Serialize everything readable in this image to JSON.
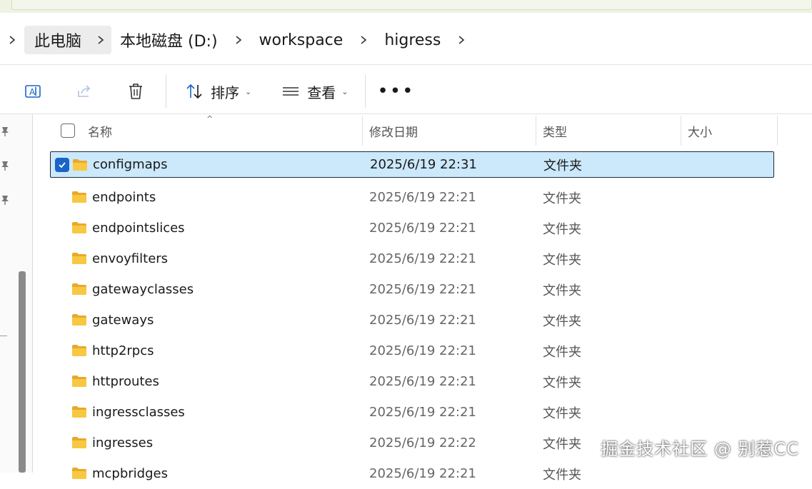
{
  "breadcrumb": {
    "items": [
      "此电脑",
      "本地磁盘 (D:)",
      "workspace",
      "higress"
    ]
  },
  "toolbar": {
    "rename_icon": "rename-icon",
    "share_icon": "share-icon",
    "delete_icon": "delete-icon",
    "sort_label": "排序",
    "view_label": "查看",
    "more_label": "•••"
  },
  "columns": {
    "name": "名称",
    "date": "修改日期",
    "type": "类型",
    "size": "大小"
  },
  "files": [
    {
      "name": "configmaps",
      "date": "2025/6/19 22:31",
      "type": "文件夹",
      "selected": true
    },
    {
      "name": "endpoints",
      "date": "2025/6/19 22:21",
      "type": "文件夹"
    },
    {
      "name": "endpointslices",
      "date": "2025/6/19 22:21",
      "type": "文件夹"
    },
    {
      "name": "envoyfilters",
      "date": "2025/6/19 22:21",
      "type": "文件夹"
    },
    {
      "name": "gatewayclasses",
      "date": "2025/6/19 22:21",
      "type": "文件夹"
    },
    {
      "name": "gateways",
      "date": "2025/6/19 22:21",
      "type": "文件夹"
    },
    {
      "name": "http2rpcs",
      "date": "2025/6/19 22:21",
      "type": "文件夹"
    },
    {
      "name": "httproutes",
      "date": "2025/6/19 22:21",
      "type": "文件夹"
    },
    {
      "name": "ingressclasses",
      "date": "2025/6/19 22:21",
      "type": "文件夹"
    },
    {
      "name": "ingresses",
      "date": "2025/6/19 22:22",
      "type": "文件夹"
    },
    {
      "name": "mcpbridges",
      "date": "2025/6/19 22:21",
      "type": "文件夹"
    }
  ],
  "watermark": "掘金技术社区 @ 别惹CC",
  "colors": {
    "selection": "#cce8fb",
    "checkbox_accent": "#1a64c6",
    "folder": "#f8c842"
  }
}
